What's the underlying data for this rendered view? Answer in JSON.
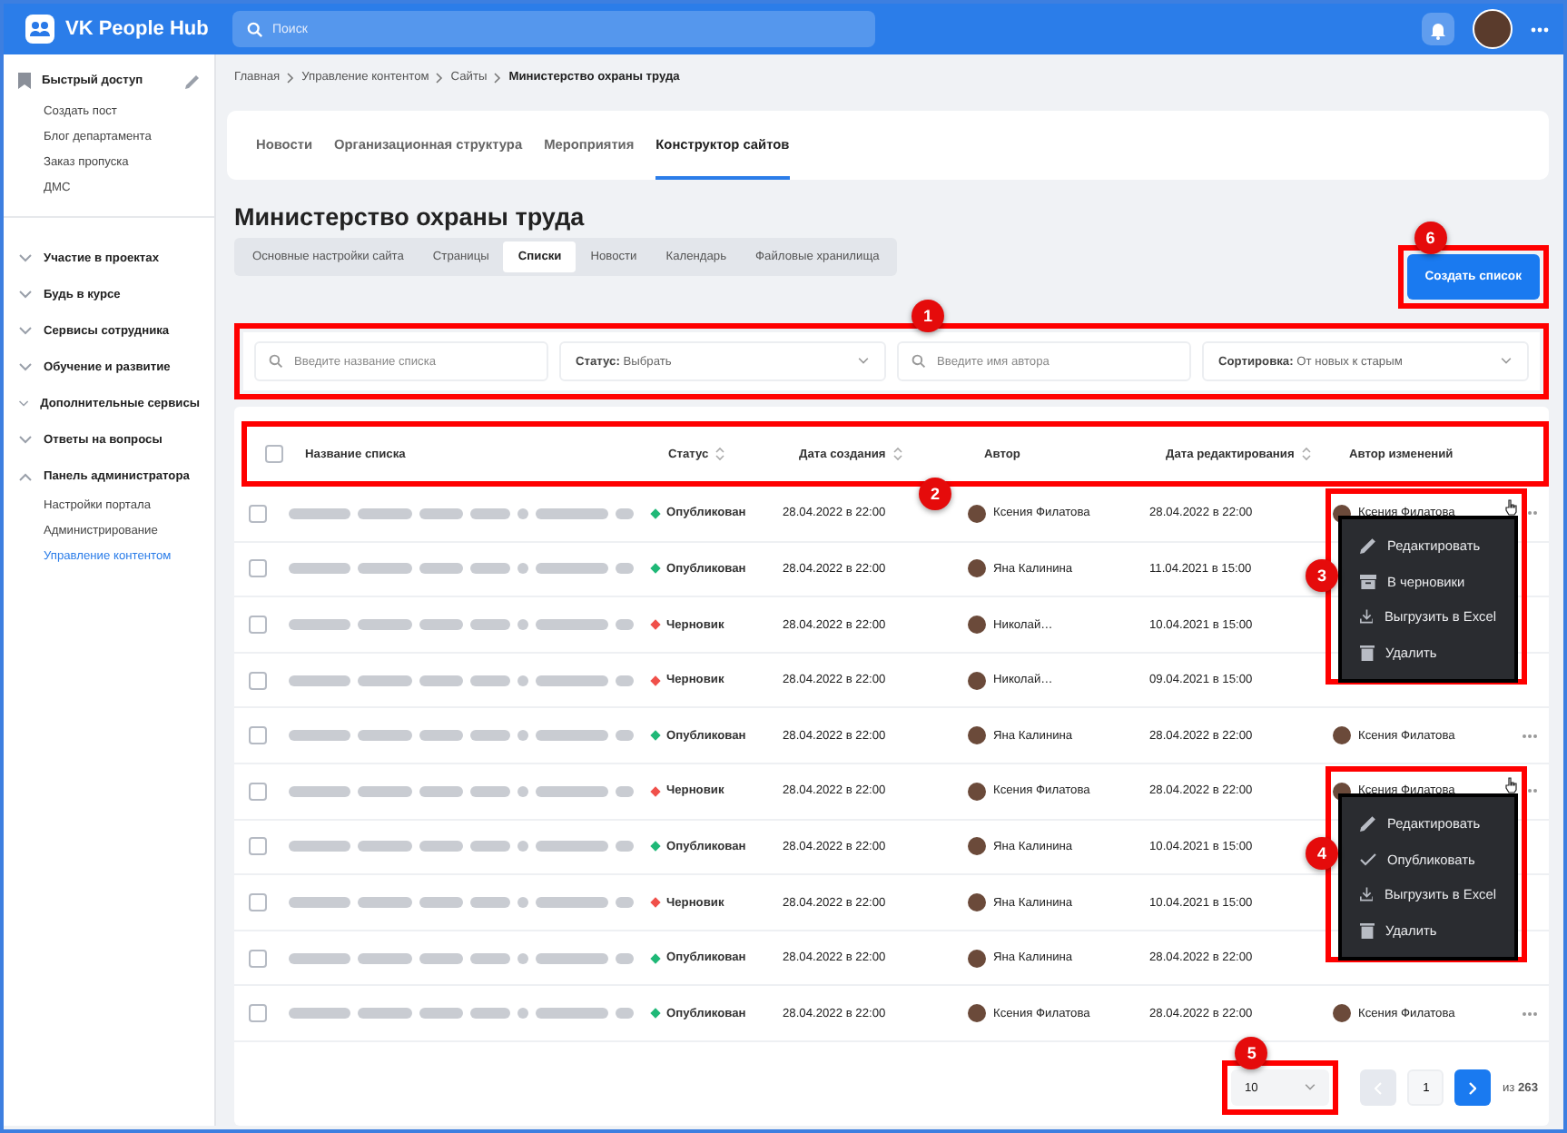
{
  "header": {
    "logo": "VK People Hub",
    "search": {
      "placeholder": "Поиск"
    }
  },
  "sidebar": {
    "quick_access": {
      "title": "Быстрый доступ",
      "items": [
        "Создать пост",
        "Блог департамента",
        "Заказ пропуска",
        "ДМС"
      ]
    },
    "sections": [
      {
        "label": "Участие в проектах",
        "expanded": false
      },
      {
        "label": "Будь в курсе",
        "expanded": false
      },
      {
        "label": "Сервисы сотрудника",
        "expanded": false
      },
      {
        "label": "Обучение и развитие",
        "expanded": false
      },
      {
        "label": "Дополнительные сервисы",
        "expanded": false
      },
      {
        "label": "Ответы на вопросы",
        "expanded": false
      },
      {
        "label": "Панель администратора",
        "expanded": true,
        "children": [
          {
            "label": "Настройки портала",
            "selected": false
          },
          {
            "label": "Администрирование",
            "selected": false
          },
          {
            "label": "Управление контентом",
            "selected": true
          }
        ]
      }
    ]
  },
  "breadcrumbs": [
    "Главная",
    "Управление контентом",
    "Сайты",
    "Министерство охраны труда"
  ],
  "tabs": [
    {
      "label": "Новости",
      "selected": false
    },
    {
      "label": "Организационная структура",
      "selected": false
    },
    {
      "label": "Мероприятия",
      "selected": false
    },
    {
      "label": "Конструктор сайтов",
      "selected": true
    }
  ],
  "page_title": "Министерство охраны труда",
  "subtabs": [
    {
      "label": "Основные настройки сайта",
      "selected": false
    },
    {
      "label": "Страницы",
      "selected": false
    },
    {
      "label": "Списки",
      "selected": true
    },
    {
      "label": "Новости",
      "selected": false
    },
    {
      "label": "Календарь",
      "selected": false
    },
    {
      "label": "Файловые хранилища",
      "selected": false
    }
  ],
  "create_button": {
    "label": "Создать список",
    "callout": "6"
  },
  "filters": {
    "callout": "1",
    "items": [
      {
        "kind": "search",
        "placeholder": "Введите название списка"
      },
      {
        "kind": "select",
        "label": "Статус:",
        "value": "Выбрать"
      },
      {
        "kind": "search",
        "placeholder": "Введите имя автора"
      },
      {
        "kind": "select",
        "label": "Сортировка:",
        "value": "От новых к старым"
      }
    ]
  },
  "table": {
    "callout": "2",
    "header_checked": false,
    "columns": [
      {
        "label": "Название списка",
        "sortable": false
      },
      {
        "label": "Статус",
        "sortable": true
      },
      {
        "label": "Дата создания",
        "sortable": true
      },
      {
        "label": "Автор",
        "sortable": false
      },
      {
        "label": "Дата редактирования",
        "sortable": true
      },
      {
        "label": "Автор изменений",
        "sortable": false
      }
    ],
    "rows": [
      {
        "checked": false,
        "status": "Опубликован",
        "color": "#1fb877",
        "created": "28.04.2022 в 22:00",
        "author": "Ксения Филатова",
        "edited": "28.04.2022 в 22:00",
        "changed_by": "Ксения Филатова",
        "menu": {
          "callout": "3",
          "items": [
            {
              "kind": "edit",
              "label": "Редактировать"
            },
            {
              "kind": "archive",
              "label": "В черновики"
            },
            {
              "kind": "export",
              "label": "Выгрузить в Excel"
            },
            {
              "kind": "delete",
              "label": "Удалить"
            }
          ]
        }
      },
      {
        "checked": false,
        "status": "Опубликован",
        "color": "#1fb877",
        "created": "28.04.2022 в 22:00",
        "author": "Яна Калинина",
        "edited": "11.04.2021 в 15:00"
      },
      {
        "checked": false,
        "status": "Черновик",
        "color": "#f0504a",
        "created": "28.04.2022 в 22:00",
        "author": "Николай…",
        "edited": "10.04.2021 в 15:00"
      },
      {
        "checked": false,
        "status": "Черновик",
        "color": "#f0504a",
        "created": "28.04.2022 в 22:00",
        "author": "Николай…",
        "edited": "09.04.2021 в 15:00"
      },
      {
        "checked": false,
        "status": "Опубликован",
        "color": "#1fb877",
        "created": "28.04.2022 в 22:00",
        "author": "Яна Калинина",
        "edited": "28.04.2022 в 22:00",
        "changed_by": "Ксения Филатова"
      },
      {
        "checked": false,
        "status": "Черновик",
        "color": "#f0504a",
        "created": "28.04.2022 в 22:00",
        "author": "Ксения Филатова",
        "edited": "28.04.2022 в 22:00",
        "changed_by": "Ксения Филатова",
        "menu": {
          "callout": "4",
          "items": [
            {
              "kind": "edit",
              "label": "Редактировать"
            },
            {
              "kind": "publish",
              "label": "Опубликовать"
            },
            {
              "kind": "export",
              "label": "Выгрузить в Excel"
            },
            {
              "kind": "delete",
              "label": "Удалить"
            }
          ]
        }
      },
      {
        "checked": false,
        "status": "Опубликован",
        "color": "#1fb877",
        "created": "28.04.2022 в 22:00",
        "author": "Яна Калинина",
        "edited": "10.04.2021 в 15:00"
      },
      {
        "checked": false,
        "status": "Черновик",
        "color": "#f0504a",
        "created": "28.04.2022 в 22:00",
        "author": "Яна Калинина",
        "edited": "10.04.2021 в 15:00"
      },
      {
        "checked": false,
        "status": "Опубликован",
        "color": "#1fb877",
        "created": "28.04.2022 в 22:00",
        "author": "Яна Калинина",
        "edited": "28.04.2022 в 22:00"
      },
      {
        "checked": false,
        "status": "Опубликован",
        "color": "#1fb877",
        "created": "28.04.2022 в 22:00",
        "author": "Ксения Филатова",
        "edited": "28.04.2022 в 22:00",
        "changed_by": "Ксения Филатова"
      }
    ]
  },
  "pagination": {
    "callout": "5",
    "page_size": "10",
    "prev_disabled": true,
    "page": "1",
    "total": "из **263**"
  }
}
